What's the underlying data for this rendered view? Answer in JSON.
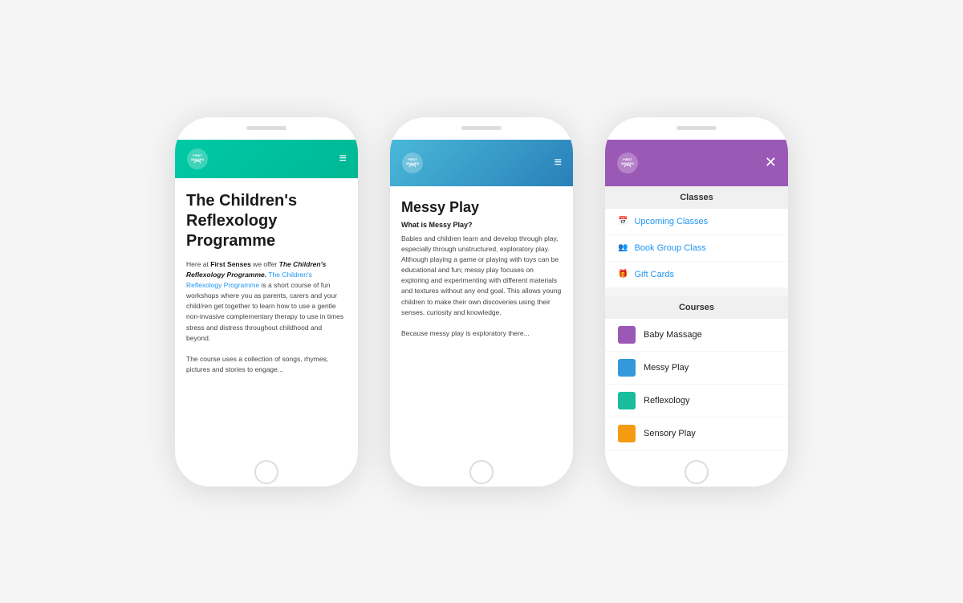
{
  "phone1": {
    "header": {
      "logo_line1": "FIRST",
      "logo_line2": "SENSES",
      "bg_color": "#00b894"
    },
    "content": {
      "title": "The Children's Reflexology Programme",
      "para1_start": "Here at ",
      "para1_brand": "First Senses",
      "para1_mid": " we offer ",
      "para1_italic": "The Children's Reflexology Programme.",
      "para1_link": "The Children's Reflexology Programme",
      "para1_rest": " is a short course of fun workshops where you as parents, carers and your child/ren get together to learn how to use a gentle non-invasive complementary therapy to use in times stress and distress throughout childhood and beyond.",
      "para2": "The course uses a collection of songs, rhymes, pictures and stories to engage..."
    }
  },
  "phone2": {
    "header": {
      "logo_line1": "FIRST",
      "logo_line2": "SENSES",
      "bg_color": "#2980b9"
    },
    "content": {
      "title": "Messy Play",
      "what_label": "What is Messy Play?",
      "para1": "Babies and children learn and develop through play, especially through unstructured, exploratory play. Although playing a game or playing with toys can be educational and fun; messy play focuses on exploring and experimenting with different materials and textures without any end goal. This allows young children to make their own discoveries using their senses, curiosity and knowledge.",
      "para2": "Because messy play is exploratory there..."
    }
  },
  "phone3": {
    "header": {
      "logo_line1": "FIRST",
      "logo_line2": "SENSES",
      "bg_color": "#9b59b6"
    },
    "menu": {
      "classes_header": "Classes",
      "upcoming_classes": "Upcoming Classes",
      "book_group_class": "Book Group Class",
      "gift_cards": "Gift Cards",
      "courses_header": "Courses",
      "courses": [
        {
          "name": "Baby Massage",
          "color_class": "icon-baby-massage"
        },
        {
          "name": "Messy Play",
          "color_class": "icon-messy-play"
        },
        {
          "name": "Reflexology",
          "color_class": "icon-reflexology"
        },
        {
          "name": "Sensory Play",
          "color_class": "icon-sensory-play"
        }
      ]
    }
  }
}
